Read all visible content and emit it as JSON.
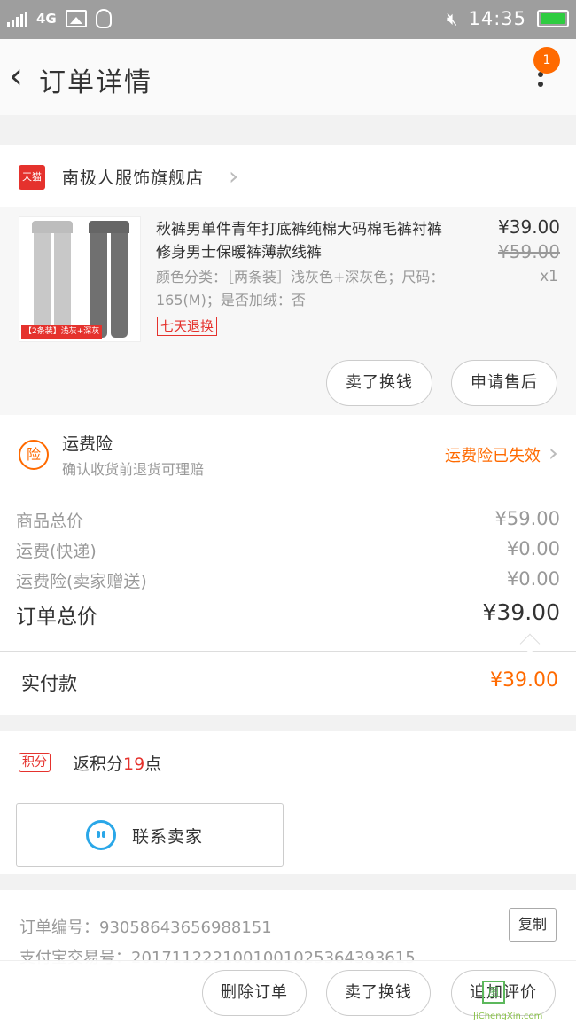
{
  "status_bar": {
    "network": "4G",
    "time": "14:35",
    "colors": {
      "bar": "#9e9e9e",
      "battery": "#2ecc40"
    }
  },
  "nav": {
    "back_icon": "chevron-left-icon",
    "title": "订单详情",
    "badge": "1",
    "more_icon": "more-vertical-icon"
  },
  "shop": {
    "logo": "天猫",
    "name": "南极人服饰旗舰店"
  },
  "product": {
    "image_tag": "【2条装】浅灰+深灰",
    "title": "秋裤男单件青年打底裤纯棉大码棉毛裤衬裤修身男士保暖裤薄款线裤",
    "spec": "颜色分类：［两条装］浅灰色+深灰色；尺码：165(M)；是否加绒：否",
    "badge": "七天退换",
    "price": "¥39.00",
    "original_price": "¥59.00",
    "quantity": "x1",
    "actions": [
      "卖了换钱",
      "申请售后"
    ]
  },
  "insurance": {
    "icon_label": "险",
    "title": "运费险",
    "subtitle": "确认收货前退货可理赔",
    "status": "运费险已失效"
  },
  "totals": {
    "rows": [
      {
        "label": "商品总价",
        "value": "¥59.00"
      },
      {
        "label": "运费(快递)",
        "value": "¥0.00"
      },
      {
        "label": "运费险(卖家赠送)",
        "value": "¥0.00"
      },
      {
        "label": "订单总价",
        "value": "¥39.00"
      }
    ]
  },
  "payment": {
    "label": "实付款",
    "value": "¥39.00"
  },
  "points": {
    "badge": "积分",
    "prefix": "返积分",
    "count": "19",
    "suffix": "点"
  },
  "contact": {
    "label": "联系卖家",
    "icon": "chat-icon"
  },
  "order_info": {
    "order_no": "订单编号：930586436569881​51",
    "trade_no": "支付宝交易号：2017112221001001025364393615",
    "copy_label": "复制"
  },
  "bottom_actions": [
    "删除订单",
    "卖了换钱",
    "追加评价"
  ],
  "watermark": {
    "text": "JiChengXin.com",
    "icon_label": "图"
  },
  "accent_colors": {
    "orange": "#ff6a00",
    "red": "#e5322d",
    "blue": "#2aa7e8"
  }
}
